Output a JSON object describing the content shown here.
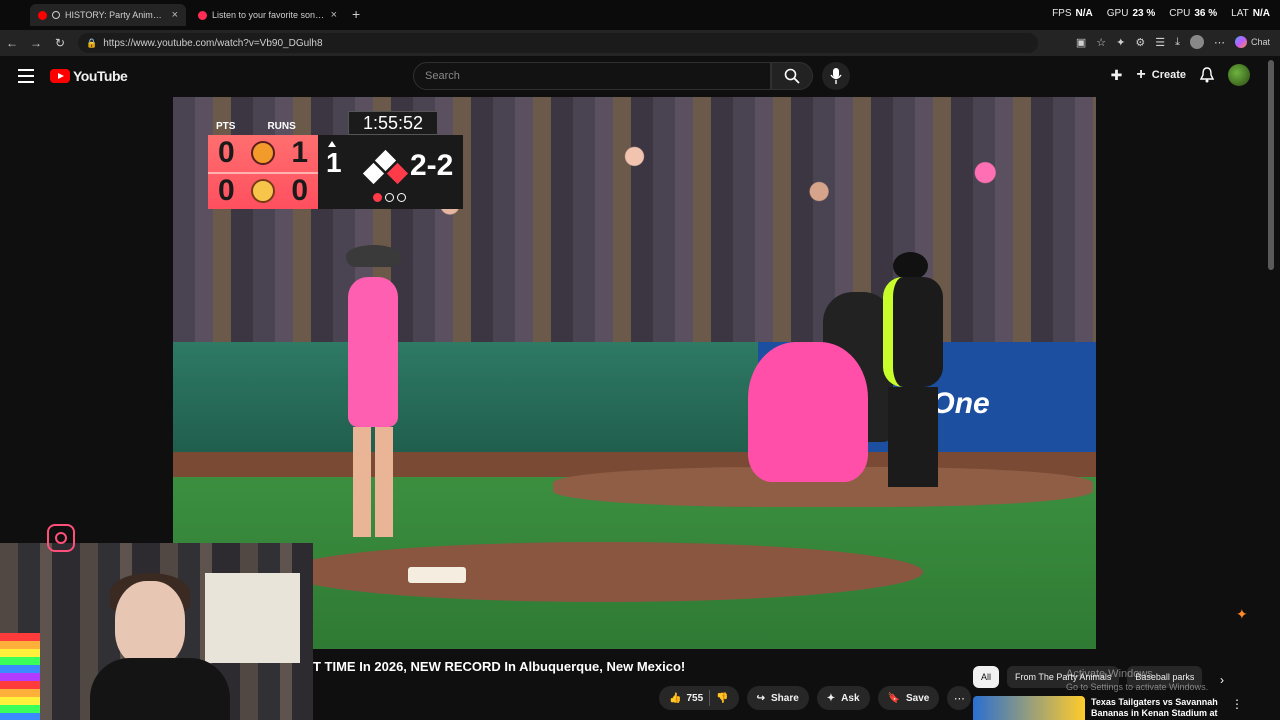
{
  "browser": {
    "tabs": [
      {
        "label": "HISTORY: Party Animals & Fir",
        "active": true,
        "favicon_color": "#ff0000"
      },
      {
        "label": "Listen to your favorite songs and",
        "active": false,
        "favicon_color": "#ff2d55"
      }
    ],
    "new_tab_glyph": "+",
    "url": "https://www.youtube.com/watch?v=Vb90_DGulh8",
    "chat_label": "Chat",
    "stats": [
      {
        "label": "FPS",
        "value": "N/A"
      },
      {
        "label": "GPU",
        "value": "23 %"
      },
      {
        "label": "CPU",
        "value": "36 %"
      },
      {
        "label": "LAT",
        "value": "N/A"
      }
    ]
  },
  "youtube": {
    "logo_text": "YouTube",
    "search_placeholder": "Search",
    "create_label": "Create"
  },
  "scoreboard": {
    "col_pts": "PTS",
    "col_runs": "RUNS",
    "clock": "1:55:52",
    "teams": [
      {
        "pts": "0",
        "runs": "1"
      },
      {
        "pts": "0",
        "runs": "0"
      }
    ],
    "inning": "1",
    "count": "2-2",
    "bases": {
      "first": true,
      "second": false,
      "third": false
    },
    "outs": [
      true,
      false,
      false
    ]
  },
  "video": {
    "ad_text": "Capital One",
    "title": "T TIME In 2026, NEW RECORD In Albuquerque, New Mexico!",
    "like_count": "755",
    "share_label": "Share",
    "ask_label": "Ask",
    "save_label": "Save"
  },
  "sidebar": {
    "chips": [
      "All",
      "From The Party Animals",
      "Baseball parks"
    ],
    "watermark_title": "Activate Windows",
    "watermark_sub": "Go to Settings to activate Windows.",
    "recommendation": {
      "title": "Texas Tailgaters vs Savannah Bananas in Kenan Stadium at ..."
    }
  },
  "colors": {
    "yt_red": "#ff0000",
    "scoreboard_red": "#ff5f6a",
    "chip_selected": "#f1f1f1"
  }
}
